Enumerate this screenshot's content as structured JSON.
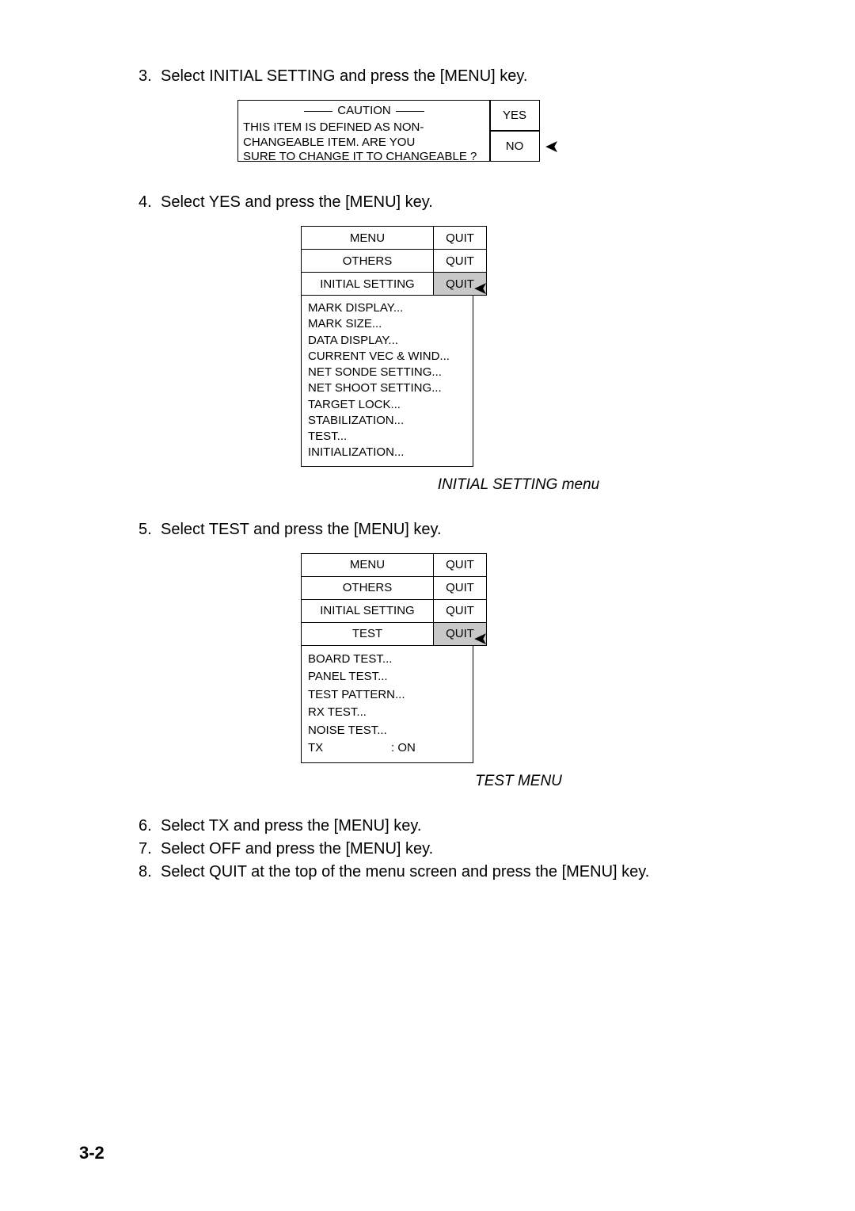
{
  "steps": {
    "s3": "Select INITIAL SETTING and press the [MENU] key.",
    "s4": "Select YES and press the [MENU] key.",
    "s5": "Select TEST and press the [MENU] key.",
    "s6": "Select TX and press the [MENU] key.",
    "s7": "Select OFF and press the [MENU] key.",
    "s8": "Select QUIT at the top of the menu screen and press the [MENU] key."
  },
  "caution": {
    "title": "CAUTION",
    "line1": "THIS ITEM IS DEFINED AS NON-",
    "line2": "CHANGEABLE ITEM. ARE YOU",
    "line3": "SURE TO CHANGE IT TO CHANGEABLE ?",
    "yes": "YES",
    "no": "NO"
  },
  "menu1": {
    "h1l": "MENU",
    "h1r": "QUIT",
    "h2l": "OTHERS",
    "h2r": "QUIT",
    "h3l": "INITIAL SETTING",
    "h3r": "QUIT",
    "items": [
      "MARK DISPLAY...",
      "MARK SIZE...",
      "DATA DISPLAY...",
      "CURRENT VEC & WIND...",
      "NET SONDE SETTING...",
      "NET SHOOT SETTING...",
      "TARGET LOCK...",
      "STABILIZATION...",
      "TEST...",
      "INITIALIZATION..."
    ],
    "caption": "INITIAL SETTING menu"
  },
  "menu2": {
    "h1l": "MENU",
    "h1r": "QUIT",
    "h2l": "OTHERS",
    "h2r": "QUIT",
    "h3l": "INITIAL SETTING",
    "h3r": "QUIT",
    "h4l": "TEST",
    "h4r": "QUIT",
    "items": [
      "BOARD TEST...",
      "PANEL TEST...",
      "TEST PATTERN...",
      "RX TEST...",
      "NOISE TEST..."
    ],
    "tx_label": "TX",
    "tx_value": ": ON",
    "caption": "TEST MENU"
  },
  "page": "3-2"
}
